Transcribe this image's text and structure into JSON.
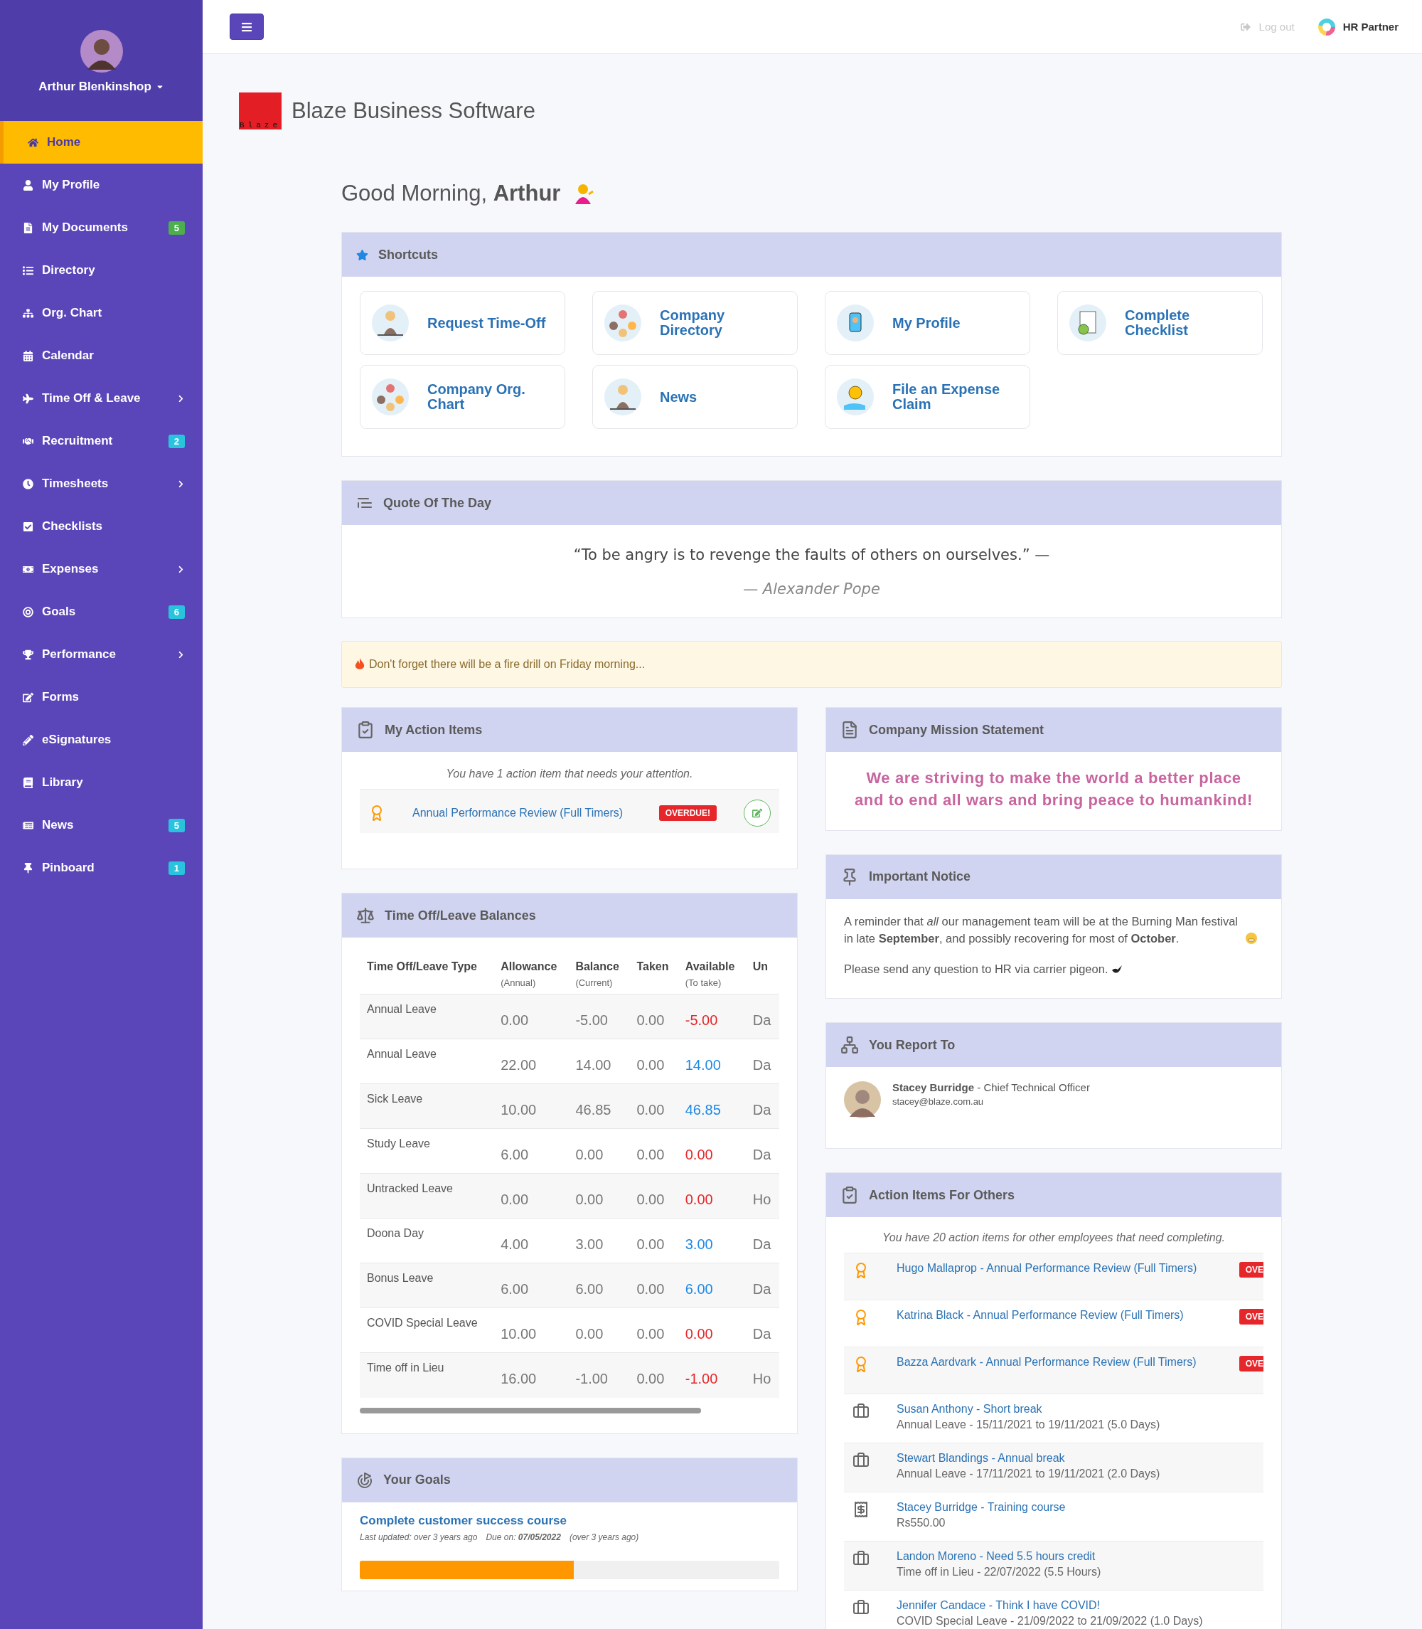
{
  "topbar": {
    "logout": "Log out",
    "brand": "HR Partner"
  },
  "sidebar": {
    "user": "Arthur Blenkinshop",
    "items": [
      {
        "label": "Home",
        "selected": true,
        "expandable": false
      },
      {
        "label": "My Profile",
        "selected": false,
        "expandable": false
      },
      {
        "label": "My Documents",
        "selected": false,
        "expandable": false,
        "badge": "5",
        "color": "#4cae4c"
      },
      {
        "label": "Directory",
        "selected": false,
        "expandable": false
      },
      {
        "label": "Org. Chart",
        "selected": false,
        "expandable": false
      },
      {
        "label": "Calendar",
        "selected": false,
        "expandable": false
      },
      {
        "label": "Time Off & Leave",
        "selected": false,
        "expandable": true
      },
      {
        "label": "Recruitment",
        "selected": false,
        "expandable": false,
        "badge": "2",
        "color": "#29c3de"
      },
      {
        "label": "Timesheets",
        "selected": false,
        "expandable": true
      },
      {
        "label": "Checklists",
        "selected": false,
        "expandable": false
      },
      {
        "label": "Expenses",
        "selected": false,
        "expandable": true
      },
      {
        "label": "Goals",
        "selected": false,
        "expandable": false,
        "badge": "6",
        "color": "#29c3de"
      },
      {
        "label": "Performance",
        "selected": false,
        "expandable": true
      },
      {
        "label": "Forms",
        "selected": false,
        "expandable": false
      },
      {
        "label": "eSignatures",
        "selected": false,
        "expandable": false
      },
      {
        "label": "Library",
        "selected": false,
        "expandable": false
      },
      {
        "label": "News",
        "selected": false,
        "expandable": false,
        "badge": "5",
        "color": "#29c3de"
      },
      {
        "label": "Pinboard",
        "selected": false,
        "expandable": false,
        "badge": "1",
        "color": "#29c3de"
      }
    ]
  },
  "company": {
    "logo_text": "Blaze",
    "name": "Blaze Business Software"
  },
  "greeting": "Good Morning, **Arthur**",
  "shortcuts": {
    "title": "Shortcuts",
    "items": [
      {
        "label": "Request Time-Off"
      },
      {
        "label": "Company\nDirectory"
      },
      {
        "label": "My Profile"
      },
      {
        "label": "Complete\nChecklist"
      },
      {
        "label": "Company Org.\nChart"
      },
      {
        "label": "News"
      },
      {
        "label": "File an Expense\nClaim"
      }
    ]
  },
  "quote": {
    "title": "Quote Of The Day",
    "text": "“To be angry is to revenge the faults of others on ourselves.” —",
    "author": "— Alexander Pope"
  },
  "alert": "Don't forget there will be a fire drill on Friday morning...",
  "my_action_items": {
    "title": "My Action Items",
    "intro": "You have 1 action item that needs your attention.",
    "items": [
      {
        "label": "Annual Performance Review (Full Timers)",
        "badge": "OVERDUE!"
      }
    ]
  },
  "leave_balances": {
    "title": "Time Off/Leave Balances",
    "columns": [
      {
        "label": "Time Off/Leave Type"
      },
      {
        "label": "Allowance",
        "sub": "(Annual)"
      },
      {
        "label": "Balance",
        "sub": "(Current)"
      },
      {
        "label": "Taken"
      },
      {
        "label": "Available",
        "sub": "(To take)"
      },
      {
        "label": "Un"
      }
    ],
    "rows": [
      {
        "type": "Annual Leave",
        "allowance": "0.00",
        "balance": "-5.00",
        "taken": "0.00",
        "available": {
          "text": "-5.00",
          "color": "#e5262a"
        },
        "unit": "Da"
      },
      {
        "type": "Annual Leave",
        "allowance": "22.00",
        "balance": "14.00",
        "taken": "0.00",
        "available": {
          "text": "14.00",
          "color": "#1e88e5"
        },
        "unit": "Da"
      },
      {
        "type": "Sick Leave",
        "allowance": "10.00",
        "balance": "46.85",
        "taken": "0.00",
        "available": {
          "text": "46.85",
          "color": "#1e88e5"
        },
        "unit": "Da"
      },
      {
        "type": "Study Leave",
        "allowance": "6.00",
        "balance": "0.00",
        "taken": "0.00",
        "available": {
          "text": "0.00",
          "color": "#e5262a"
        },
        "unit": "Da"
      },
      {
        "type": "Untracked Leave",
        "allowance": "0.00",
        "balance": "0.00",
        "taken": "0.00",
        "available": {
          "text": "0.00",
          "color": "#e5262a"
        },
        "unit": "Ho"
      },
      {
        "type": "Doona Day",
        "allowance": "4.00",
        "balance": "3.00",
        "taken": "0.00",
        "available": {
          "text": "3.00",
          "color": "#1e88e5"
        },
        "unit": "Da"
      },
      {
        "type": "Bonus Leave",
        "allowance": "6.00",
        "balance": "6.00",
        "taken": "0.00",
        "available": {
          "text": "6.00",
          "color": "#1e88e5"
        },
        "unit": "Da"
      },
      {
        "type": "COVID Special Leave",
        "allowance": "10.00",
        "balance": "0.00",
        "taken": "0.00",
        "available": {
          "text": "0.00",
          "color": "#e5262a"
        },
        "unit": "Da"
      },
      {
        "type": "Time off in Lieu",
        "allowance": "16.00",
        "balance": "-1.00",
        "taken": "0.00",
        "available": {
          "text": "-1.00",
          "color": "#e5262a"
        },
        "unit": "Ho"
      }
    ]
  },
  "goals": {
    "title": "Your Goals",
    "items": [
      {
        "title": "Complete customer success course",
        "updated": "Last updated: over 3 years ago",
        "due": "Due on: **07/05/2022**",
        "ago": "(over 3 years ago)",
        "level": 0.51
      }
    ]
  },
  "mission": {
    "title": "Company Mission Statement",
    "text": "We are striving to make the world a better place\nand to end all wars and bring peace to humankind!"
  },
  "notice": {
    "title": "Important Notice",
    "paragraphs": [
      "A reminder that *all* our management team will be at the Burning Man festival in late **September**, and possibly recovering for most of **October**.",
      "Please send any question to HR via carrier pigeon."
    ]
  },
  "report_to": {
    "title": "You Report To",
    "name": "Stacey Burridge",
    "role": " - Chief Technical Officer",
    "email": "stacey@blaze.com.au"
  },
  "others": {
    "title": "Action Items For Others",
    "intro": "You have 20 action items for other employees that need completing.",
    "items": [
      {
        "kind": "review",
        "label": "Hugo Mallaprop - Annual Performance Review (Full Timers)",
        "badge": "OVE"
      },
      {
        "kind": "review",
        "label": "Katrina Black - Annual Performance Review (Full Timers)",
        "badge": "OVE"
      },
      {
        "kind": "review",
        "label": "Bazza Aardvark - Annual Performance Review (Full Timers)",
        "badge": "OVE"
      },
      {
        "kind": "leave",
        "label": "Susan Anthony - Short break",
        "detail": "Annual Leave - 15/11/2021 to 19/11/2021 (5.0 Days)"
      },
      {
        "kind": "leave",
        "label": "Stewart Blandings - Annual break",
        "detail": "Annual Leave - 17/11/2021 to 19/11/2021 (2.0 Days)"
      },
      {
        "kind": "expense",
        "label": "Stacey Burridge - Training course",
        "detail": "Rs550.00"
      },
      {
        "kind": "leave",
        "label": "Landon Moreno - Need 5.5 hours credit",
        "detail": "Time off in Lieu - 22/07/2022 (5.5 Hours)"
      },
      {
        "kind": "leave",
        "label": "Jennifer Candace - Think I have COVID!",
        "detail": "COVID Special Leave - 21/09/2022 to 21/09/2022 (1.0 Days)"
      }
    ]
  }
}
